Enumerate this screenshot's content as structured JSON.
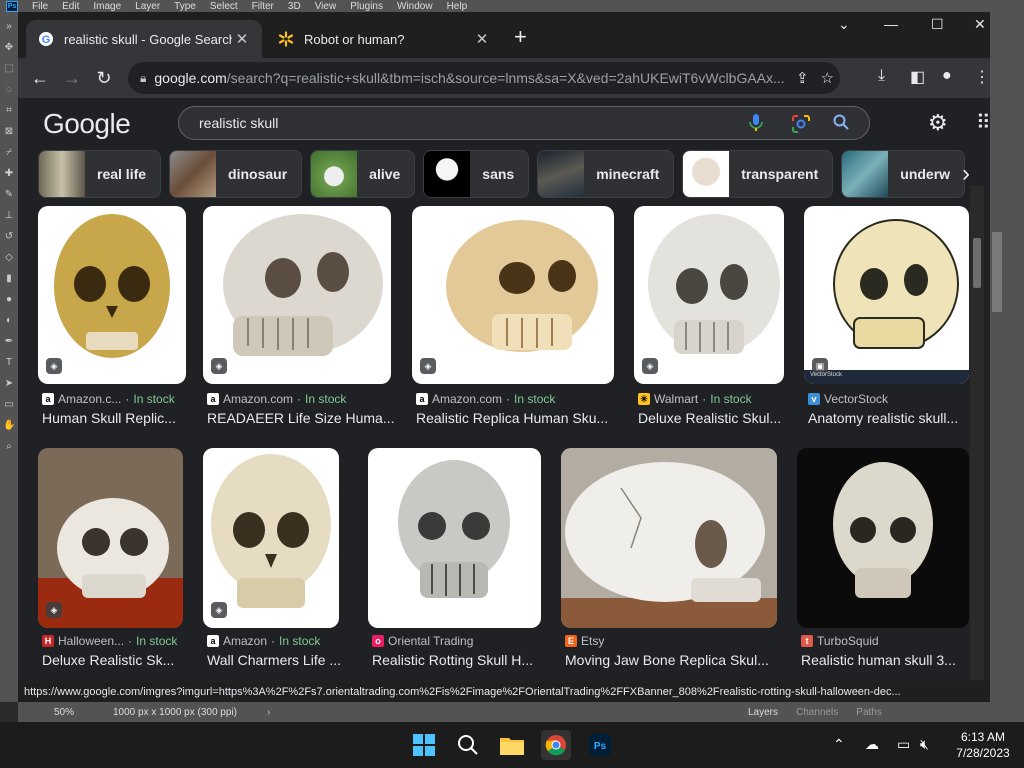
{
  "photoshop": {
    "menu": [
      "File",
      "Edit",
      "Image",
      "Layer",
      "Type",
      "Select",
      "Filter",
      "3D",
      "View",
      "Plugins",
      "Window",
      "Help"
    ],
    "logo": "Ps",
    "status_zoom": "50%",
    "status_dims": "1000 px x 1000 px (300 ppi)",
    "panel_tabs": [
      "Layers",
      "Channels",
      "Paths"
    ]
  },
  "browser": {
    "tabs": [
      {
        "title": "realistic skull - Google Search",
        "active": true
      },
      {
        "title": "Robot or human?",
        "active": false
      }
    ],
    "address": {
      "host": "google.com",
      "path": "/search?q=realistic+skull&tbm=isch&source=lnms&sa=X&ved=2ahUKEwiT6vWclbGAAx..."
    },
    "status_url": "https://www.google.com/imgres?imgurl=https%3A%2F%2Fs7.orientaltrading.com%2Fis%2Fimage%2FOrientalTrading%2FFXBanner_808%2Frealistic-rotting-skull-halloween-dec..."
  },
  "search": {
    "logo": "Google",
    "query": "realistic skull",
    "chips": [
      "real life",
      "dinosaur",
      "alive",
      "sans",
      "minecraft",
      "transparent",
      "underw"
    ]
  },
  "results_row1": [
    {
      "source": "Amazon.c...",
      "stock": "In stock",
      "caption": "Human Skull Replic...",
      "fav": "a"
    },
    {
      "source": "Amazon.com",
      "stock": "In stock",
      "caption": "READAEER Life Size Huma...",
      "fav": "a"
    },
    {
      "source": "Amazon.com",
      "stock": "In stock",
      "caption": "Realistic Replica Human Sku...",
      "fav": "a"
    },
    {
      "source": "Walmart",
      "stock": "In stock",
      "caption": "Deluxe Realistic Skul...",
      "fav": "w"
    },
    {
      "source": "VectorStock",
      "stock": "",
      "caption": "Anatomy realistic skull...",
      "fav": "v"
    }
  ],
  "results_row2": [
    {
      "source": "Halloween...",
      "stock": "In stock",
      "caption": "Deluxe Realistic Sk...",
      "fav": "h"
    },
    {
      "source": "Amazon",
      "stock": "In stock",
      "caption": "Wall Charmers Life ...",
      "fav": "a"
    },
    {
      "source": "Oriental Trading",
      "stock": "",
      "caption": "Realistic Rotting Skull H...",
      "fav": "o"
    },
    {
      "source": "Etsy",
      "stock": "",
      "caption": "Moving Jaw Bone Replica Skul...",
      "fav": "e"
    },
    {
      "source": "TurboSquid",
      "stock": "",
      "caption": "Realistic human skull 3...",
      "fav": "t"
    }
  ],
  "image_labels": {
    "vectorstock": "VectorStock"
  },
  "clock": {
    "time": "6:13 AM",
    "date": "7/28/2023"
  },
  "colors": {
    "accent_blue": "#8ab4f8",
    "in_stock": "#81c995",
    "page_bg": "#202124"
  }
}
